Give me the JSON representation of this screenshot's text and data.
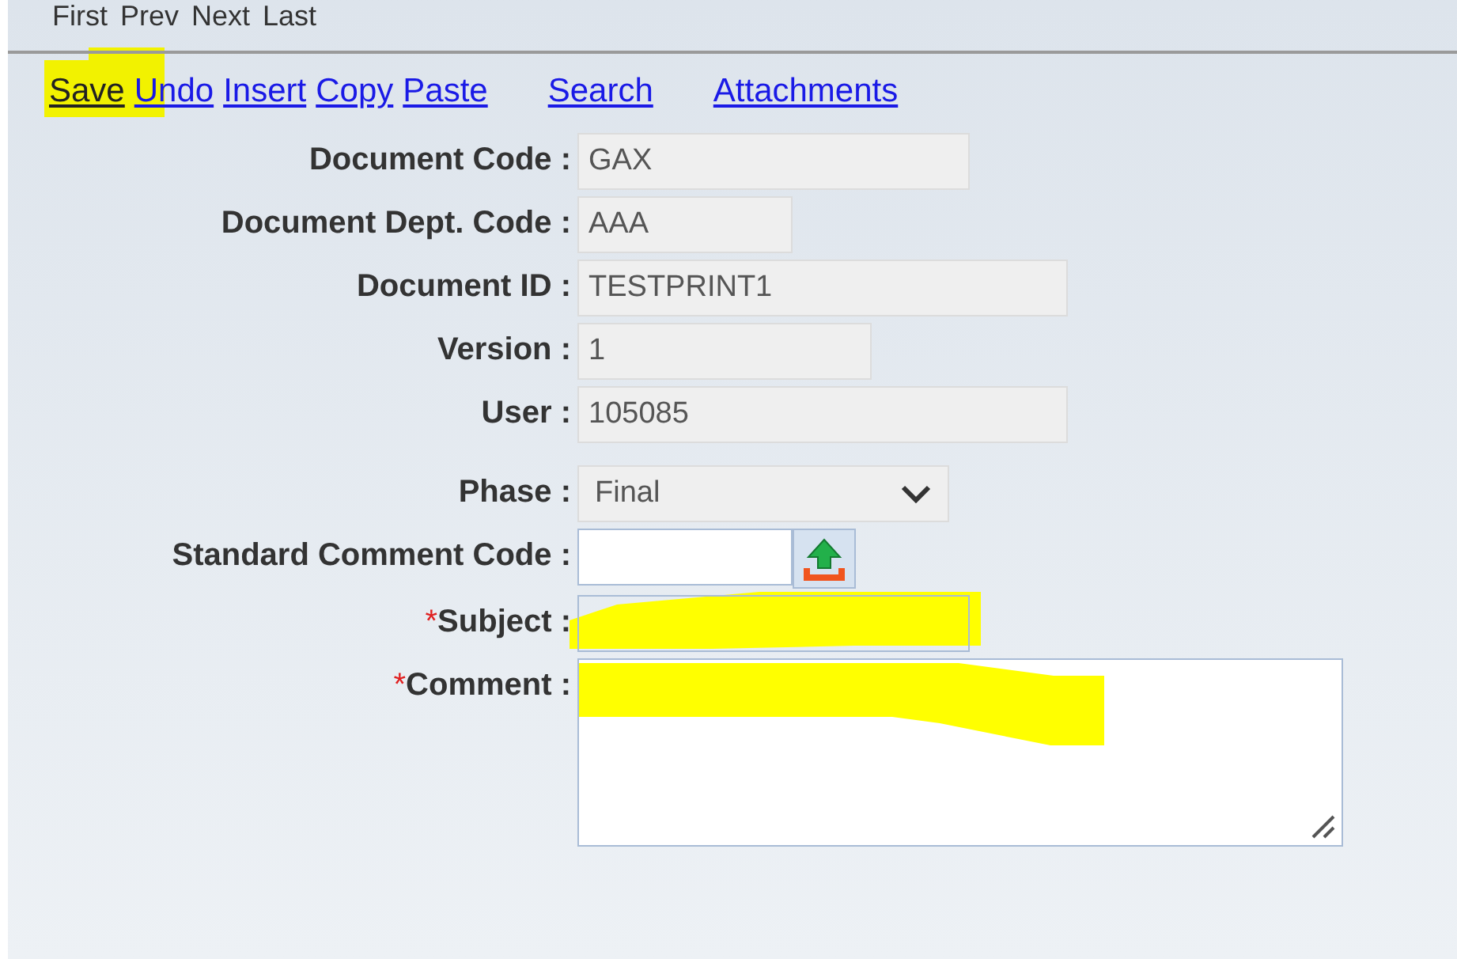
{
  "nav_links": [
    "First",
    "Prev",
    "Next",
    "Last"
  ],
  "toolbar_groups": [
    {
      "links": [
        "Save",
        "Undo",
        "Insert",
        "Copy",
        "Paste"
      ]
    },
    {
      "links": [
        "Search"
      ]
    },
    {
      "links": [
        "Attachments"
      ]
    }
  ],
  "fields": [
    {
      "kind": "text",
      "label": "Document Code :",
      "value": "GAX",
      "disabled": true
    },
    {
      "kind": "text",
      "label": "Document Dept. Code :",
      "value": "AAA",
      "disabled": true
    },
    {
      "kind": "text",
      "label": "Document ID :",
      "value": "TESTPRINT1",
      "disabled": true
    },
    {
      "kind": "text",
      "label": "Version :",
      "value": "1",
      "disabled": true
    },
    {
      "kind": "text",
      "label": "User :",
      "value": "105085",
      "disabled": true
    },
    {
      "kind": "select",
      "label": "Phase :",
      "value": "Final",
      "disabled": true
    },
    {
      "kind": "lookup",
      "label": "Standard Comment Code :",
      "disabled": false
    },
    {
      "kind": "text",
      "label": "Subject :",
      "required_mark": "*",
      "disabled": false
    },
    {
      "kind": "textarea",
      "label": "Comment :",
      "required_mark": "*",
      "disabled": false
    }
  ]
}
